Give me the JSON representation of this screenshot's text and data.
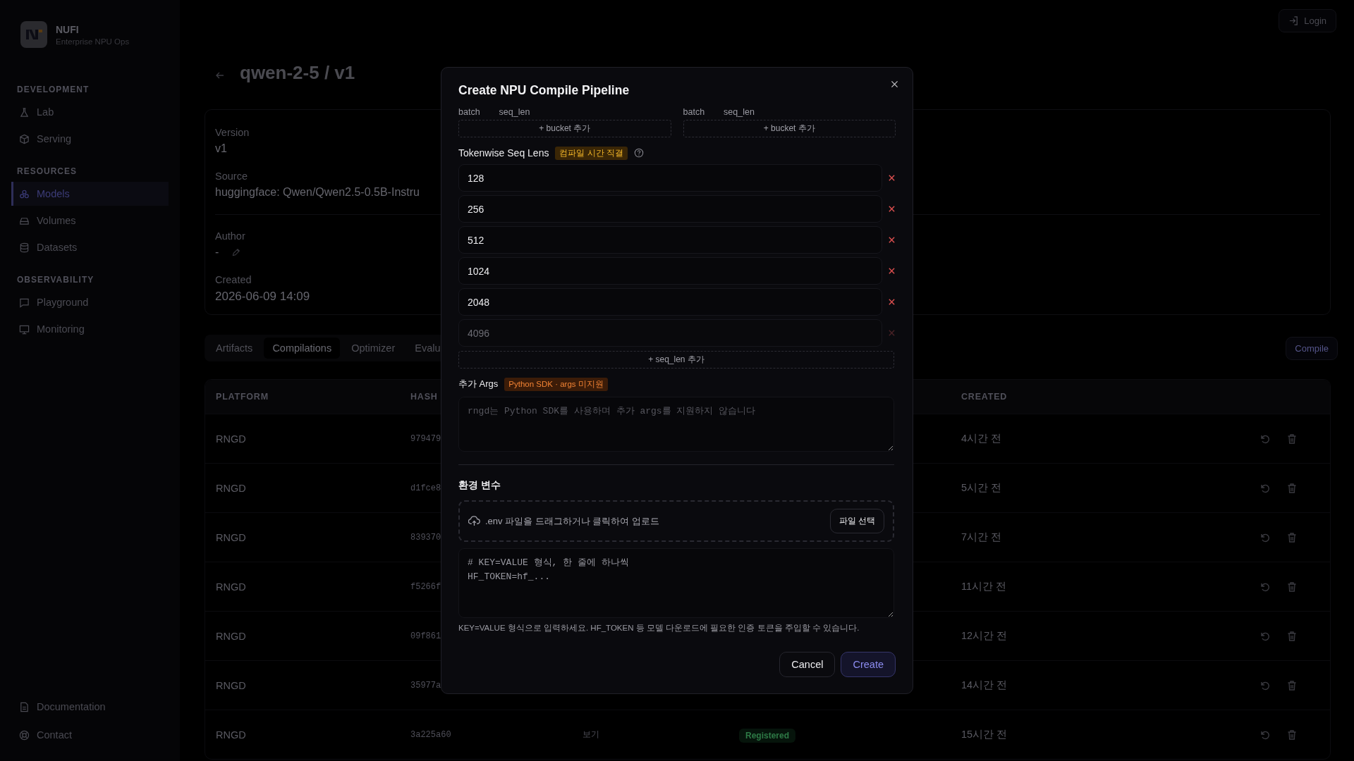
{
  "app": {
    "name": "NUFI",
    "subtitle": "Enterprise NPU Ops"
  },
  "sidebar": {
    "sections": [
      {
        "heading": "DEVELOPMENT",
        "items": [
          {
            "label": "Lab",
            "selected": false
          },
          {
            "label": "Serving",
            "selected": false
          }
        ]
      },
      {
        "heading": "RESOURCES",
        "items": [
          {
            "label": "Models",
            "selected": true
          },
          {
            "label": "Volumes",
            "selected": false
          },
          {
            "label": "Datasets",
            "selected": false
          }
        ]
      },
      {
        "heading": "OBSERVABILITY",
        "items": [
          {
            "label": "Playground",
            "selected": false
          },
          {
            "label": "Monitoring",
            "selected": false
          }
        ]
      }
    ],
    "footer_items": [
      {
        "label": "Documentation"
      },
      {
        "label": "Contact"
      }
    ]
  },
  "login_button": "Login",
  "page": {
    "title": "qwen-2-5 / v1"
  },
  "details": [
    {
      "label": "Version",
      "value": "v1"
    },
    {
      "label": "Source",
      "value": "huggingface: Qwen/Qwen2.5-0.5B-Instru"
    },
    {
      "label": "Author",
      "value": "-"
    },
    {
      "label": "Created",
      "value": "2026-06-09 14:09"
    }
  ],
  "tabs": [
    {
      "label": "Artifacts",
      "selected": false
    },
    {
      "label": "Compilations",
      "selected": true
    },
    {
      "label": "Optimizer",
      "selected": false
    },
    {
      "label": "Evalu",
      "selected": false
    }
  ],
  "compile_button": "Compile",
  "table": {
    "columns": [
      "PLATFORM",
      "HASH",
      "CREATED"
    ],
    "rows": [
      {
        "platform": "RNGD",
        "hash": "979479",
        "created": "4시간 전"
      },
      {
        "platform": "RNGD",
        "hash": "d1fce8",
        "created": "5시간 전"
      },
      {
        "platform": "RNGD",
        "hash": "839370",
        "created": "7시간 전"
      },
      {
        "platform": "RNGD",
        "hash": "f5266f",
        "created": "11시간 전"
      },
      {
        "platform": "RNGD",
        "hash": "09f861",
        "created": "12시간 전"
      },
      {
        "platform": "RNGD",
        "hash": "35977a",
        "created": "14시간 전"
      },
      {
        "platform": "RNGD",
        "hash": "3a225a60",
        "column_3": "보기",
        "status": "Registered",
        "created": "15시간 전"
      }
    ]
  },
  "dialog": {
    "title": "Create NPU Compile Pipeline",
    "bucket_groups": [
      {
        "labels": [
          "batch",
          "seq_len"
        ],
        "add_button": "+ bucket 추가"
      },
      {
        "labels": [
          "batch",
          "seq_len"
        ],
        "add_button": "+ bucket 추가"
      }
    ],
    "seq_lens": {
      "label": "Tokenwise Seq Lens",
      "badge": "컴파일 시간 직결",
      "items": [
        {
          "value": "128",
          "disabled": false
        },
        {
          "value": "256",
          "disabled": false
        },
        {
          "value": "512",
          "disabled": false
        },
        {
          "value": "1024",
          "disabled": false
        },
        {
          "value": "2048",
          "disabled": false
        },
        {
          "value": "4096",
          "disabled": true
        }
      ],
      "add_button": "+ seq_len 추가"
    },
    "extra_args": {
      "label": "추가 Args",
      "badge": "Python SDK · args 미지원",
      "placeholder": "rngd는 Python SDK를 사용하며 추가 args를 지원하지 않습니다"
    },
    "env": {
      "heading": "환경 변수",
      "dropzone_text": ".env 파일을 드래그하거나 클릭하여 업로드",
      "file_button": "파일 선택",
      "placeholder": "# KEY=VALUE 형식, 한 줄에 하나씩\nHF_TOKEN=hf_...",
      "hint": "KEY=VALUE 형식으로 입력하세요. HF_TOKEN 등 모델 다운로드에 필요한 인증 토큰을 주입할 수 있습니다."
    },
    "buttons": [
      {
        "label": "Cancel",
        "kind": "secondary"
      },
      {
        "label": "Create",
        "kind": "primary"
      }
    ]
  }
}
